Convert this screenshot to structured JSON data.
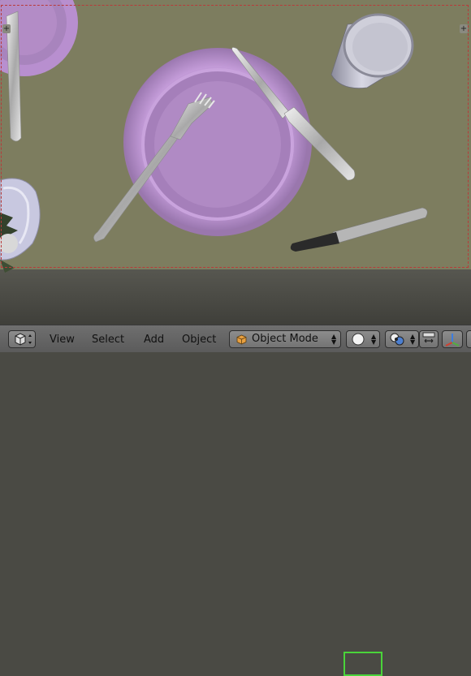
{
  "header": {
    "menu": [
      {
        "label": "View"
      },
      {
        "label": "Select"
      },
      {
        "label": "Add"
      },
      {
        "label": "Object"
      }
    ],
    "mode_dropdown": {
      "label": "Object Mode",
      "icon": "cube-icon"
    },
    "viewport_shading": {
      "icon": "solid-sphere-icon",
      "selected": true
    },
    "pivot_point": {
      "icon": "pivot-icon"
    },
    "extra_icons": [
      "snap-icon",
      "manipulator-icon"
    ]
  },
  "viewport": {
    "objects": [
      "plate-large",
      "plate-corner",
      "fork",
      "knife",
      "glass",
      "marker",
      "vase",
      "plant"
    ]
  },
  "colors": {
    "table": "#7d7d5f",
    "plate": "#b78fcc",
    "highlight": "#4ad43a"
  }
}
